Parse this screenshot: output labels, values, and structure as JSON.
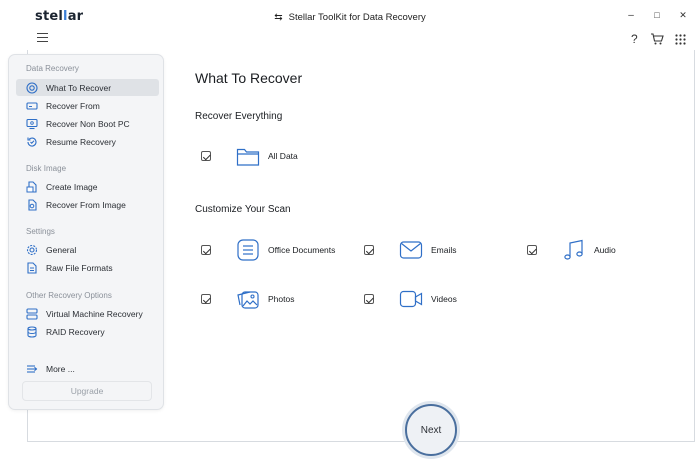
{
  "app": {
    "logo_prefix": "stel",
    "logo_accent": "l",
    "logo_suffix": "ar",
    "title": "Stellar ToolKit for Data Recovery",
    "window_controls": {
      "minimize": "–",
      "maximize": "□",
      "close": "✕"
    }
  },
  "toolbar": {
    "help": "?"
  },
  "sidebar": {
    "sections": [
      {
        "title": "Data Recovery",
        "items": [
          {
            "label": "What To Recover",
            "icon": "target-icon",
            "active": true
          },
          {
            "label": "Recover From",
            "icon": "drive-icon"
          },
          {
            "label": "Recover Non Boot PC",
            "icon": "monitor-icon"
          },
          {
            "label": "Resume Recovery",
            "icon": "resume-icon"
          }
        ]
      },
      {
        "title": "Disk Image",
        "items": [
          {
            "label": "Create Image",
            "icon": "create-image-icon"
          },
          {
            "label": "Recover From Image",
            "icon": "recover-image-icon"
          }
        ]
      },
      {
        "title": "Settings",
        "items": [
          {
            "label": "General",
            "icon": "gear-icon"
          },
          {
            "label": "Raw File Formats",
            "icon": "file-formats-icon"
          }
        ]
      },
      {
        "title": "Other Recovery Options",
        "items": [
          {
            "label": "Virtual Machine Recovery",
            "icon": "vm-icon"
          },
          {
            "label": "RAID Recovery",
            "icon": "raid-icon"
          }
        ]
      }
    ],
    "more": "More ...",
    "upgrade": "Upgrade"
  },
  "main": {
    "title": "What To Recover",
    "recover_everything": {
      "heading": "Recover Everything",
      "options": [
        {
          "label": "All Data",
          "checked": true,
          "icon": "folder-icon"
        }
      ]
    },
    "customize": {
      "heading": "Customize Your Scan",
      "options": [
        {
          "label": "Office Documents",
          "checked": true,
          "icon": "document-icon"
        },
        {
          "label": "Emails",
          "checked": true,
          "icon": "email-icon"
        },
        {
          "label": "Audio",
          "checked": true,
          "icon": "music-icon"
        },
        {
          "label": "Photos",
          "checked": true,
          "icon": "photos-icon"
        },
        {
          "label": "Videos",
          "checked": true,
          "icon": "video-icon"
        }
      ]
    },
    "next": "Next"
  },
  "colors": {
    "accent": "#2f6fc7",
    "logo_accent": "#3b7fd6",
    "next_border": "#4a6f9e"
  }
}
